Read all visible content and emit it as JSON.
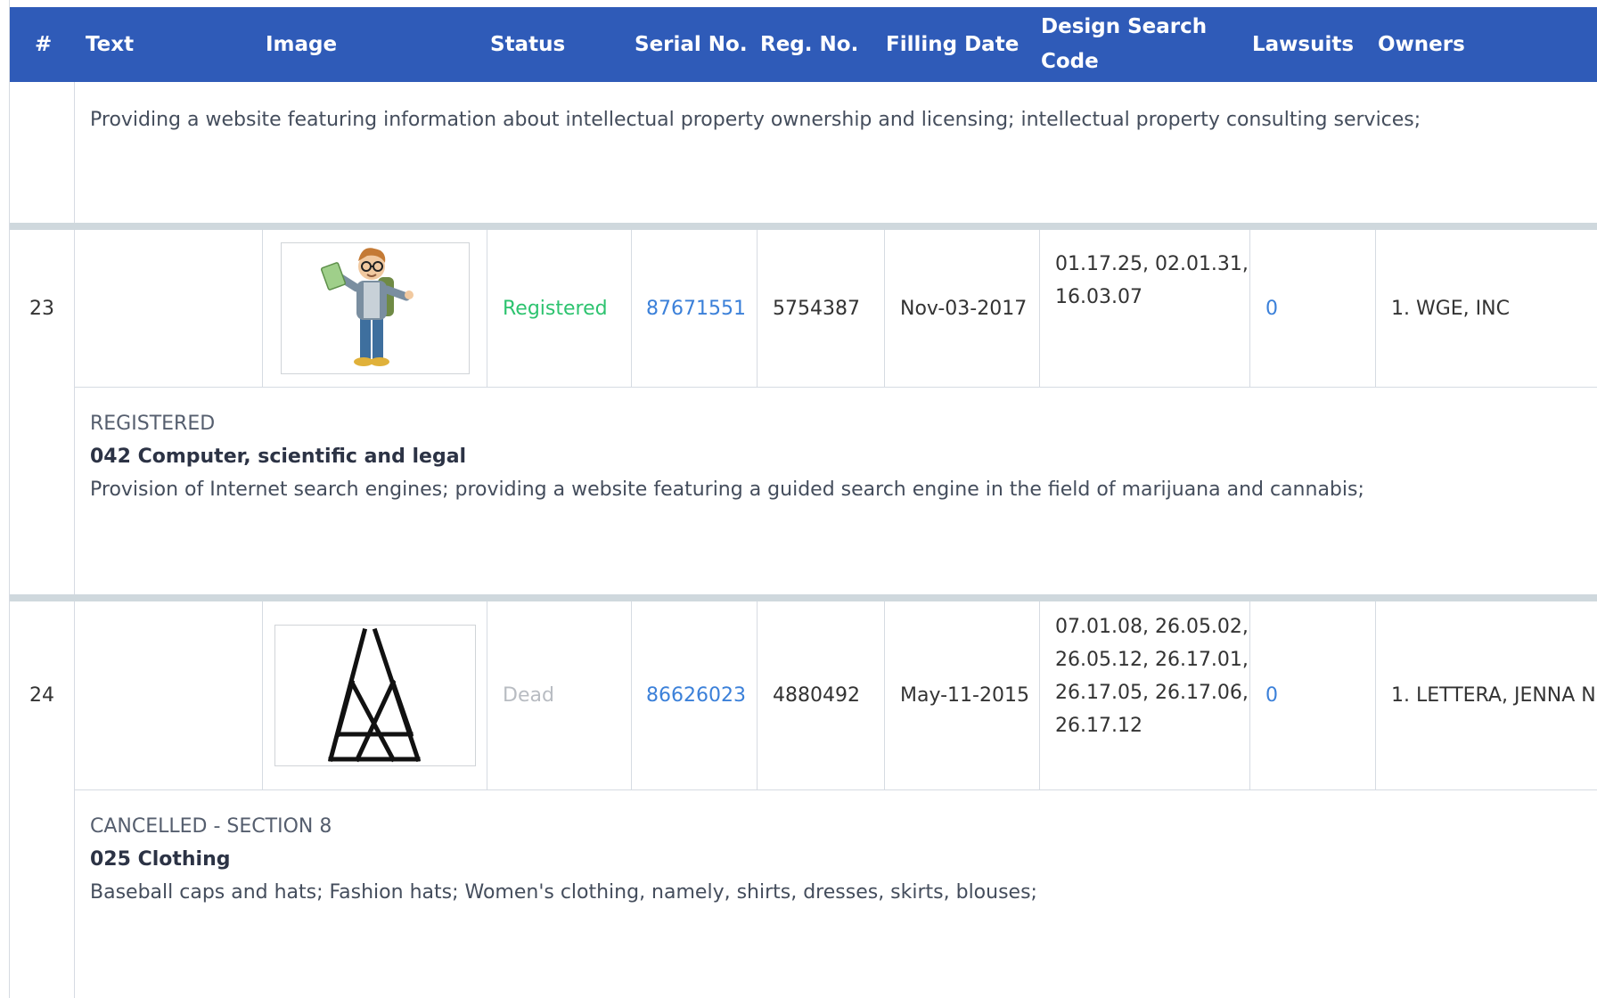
{
  "columns": {
    "num": "#",
    "text": "Text",
    "image": "Image",
    "status": "Status",
    "serial": "Serial No.",
    "reg": "Reg. No.",
    "filing": "Filling Date",
    "design_line1": "Design Search",
    "design_line2": "Code",
    "lawsuits": "Lawsuits",
    "owners": "Owners"
  },
  "top_detail": {
    "goods": "Providing a website featuring information about intellectual property ownership and licensing; intellectual property consulting services;"
  },
  "rows": [
    {
      "num": "23",
      "image_icon": "cartoon-man-holding-money-image",
      "status": "Registered",
      "serial": "87671551",
      "reg_no": "5754387",
      "filing_date": "Nov-03-2017",
      "design_codes_line1": "01.17.25, 02.01.31,",
      "design_codes_line2": "16.03.07",
      "lawsuits": "0",
      "owners": "1. WGE, INC",
      "detail": {
        "status_word": "REGISTERED",
        "class_title": "042 Computer, scientific and legal",
        "goods": "Provision of Internet search engines; providing a website featuring a guided search engine in the field of marijuana and cannabis;"
      }
    },
    {
      "num": "24",
      "image_icon": "teepee-triangle-logo-image",
      "status": "Dead",
      "serial": "86626023",
      "reg_no": "4880492",
      "filing_date": "May-11-2015",
      "design_codes_line1": "07.01.08, 26.05.02,",
      "design_codes_line2": "26.05.12, 26.17.01,",
      "design_codes_line3": "26.17.05, 26.17.06,",
      "design_codes_line4": "26.17.12",
      "lawsuits": "0",
      "owners": "1. LETTERA, JENNA N",
      "detail": {
        "status_word": "CANCELLED - SECTION 8",
        "class_title": "025 Clothing",
        "goods": "Baseball caps and hats; Fashion hats; Women's clothing, namely, shirts, dresses, skirts, blouses;"
      }
    }
  ],
  "colors": {
    "header_bg": "#2f5bb8",
    "link": "#3b80d9",
    "registered": "#2dc36f",
    "dead": "#b8bcc2",
    "separator": "#cfd8dd"
  }
}
